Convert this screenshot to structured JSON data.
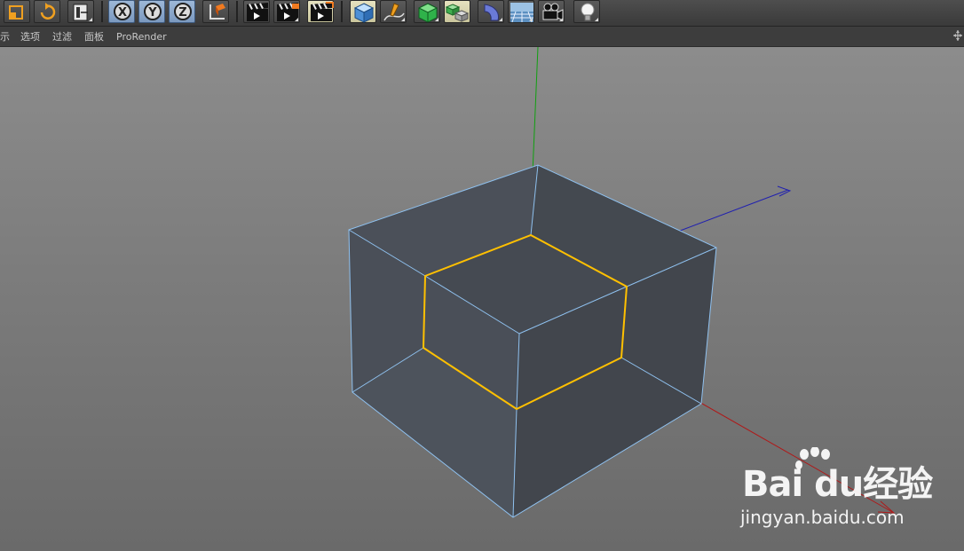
{
  "menu": {
    "items": [
      {
        "label": "示"
      },
      {
        "label": "选项"
      },
      {
        "label": "过滤"
      },
      {
        "label": "面板"
      },
      {
        "label": "ProRender"
      }
    ]
  },
  "toolbar": {
    "buttons": [
      {
        "icon": "scale-icon"
      },
      {
        "icon": "rotate-icon"
      },
      {
        "icon": "coordinate-frame-icon"
      },
      {
        "icon": "x-axis-lock-icon",
        "label": "X"
      },
      {
        "icon": "y-axis-lock-icon",
        "label": "Y"
      },
      {
        "icon": "z-axis-lock-icon",
        "label": "Z"
      },
      {
        "icon": "world-coordinates-icon"
      },
      {
        "icon": "render-view-icon"
      },
      {
        "icon": "render-picture-viewer-icon"
      },
      {
        "icon": "edit-render-settings-icon"
      },
      {
        "icon": "cube-icon"
      },
      {
        "icon": "pen-spline-icon"
      },
      {
        "icon": "subdivision-surface-icon"
      },
      {
        "icon": "array-clone-icon"
      },
      {
        "icon": "deformer-bend-icon"
      },
      {
        "icon": "floor-icon"
      },
      {
        "icon": "camera-icon"
      },
      {
        "icon": "light-icon"
      }
    ]
  },
  "colors": {
    "toolbar_bg": "#444444",
    "viewport_top": "#8c8c8c",
    "viewport_bottom": "#6a6a6a",
    "mesh_face": "#4a4f56",
    "mesh_edge": "#8fc1ef",
    "selection": "#ffc000",
    "axis_x": "#b01818",
    "axis_y": "#10a010",
    "axis_z": "#2020b0"
  },
  "watermark": {
    "logo": "Bai du经验",
    "url": "jingyan.baidu.com"
  }
}
